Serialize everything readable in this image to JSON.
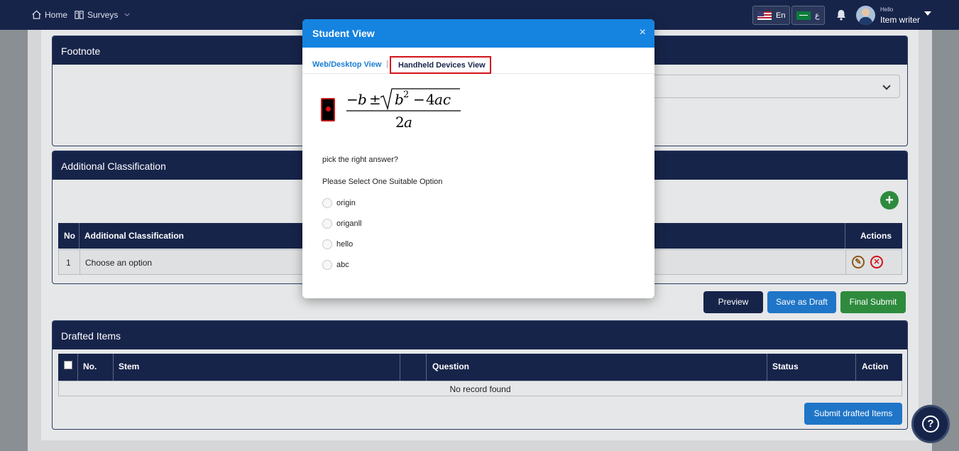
{
  "topbar": {
    "home_label": "Home",
    "surveys_label": "Surveys",
    "lang_en": "En",
    "lang_ar": "ع",
    "user_greeting": "Hello",
    "user_name": "Item writer"
  },
  "footnote": {
    "title": "Footnote"
  },
  "additional_classification": {
    "title": "Additional Classification",
    "columns": [
      "No",
      "Additional Classification",
      "Actions"
    ],
    "rows": [
      {
        "no": "1",
        "value": "Choose an option"
      }
    ]
  },
  "action_buttons": {
    "preview": "Preview",
    "save_draft": "Save as Draft",
    "final_submit": "Final Submit"
  },
  "drafted_items": {
    "title": "Drafted Items",
    "columns": [
      "No.",
      "Stem",
      "Question",
      "Status",
      "Action"
    ],
    "empty_message": "No record found",
    "submit_label": "Submit drafted Items"
  },
  "modal": {
    "title": "Student View",
    "close_glyph": "×",
    "tabs": {
      "web": "Web/Desktop View",
      "separator": "|",
      "handheld": "Handheld Devices View"
    },
    "question": "pick the right answer?",
    "instruction": "Please Select One Suitable Option",
    "options": [
      "origin",
      "origanll",
      "hello",
      "abc"
    ]
  },
  "colors": {
    "navy": "#17244a",
    "modal_blue": "#1583e0",
    "save_blue": "#1f75c7",
    "submit_green": "#2e8b3d",
    "highlight_red": "#d3141c"
  }
}
